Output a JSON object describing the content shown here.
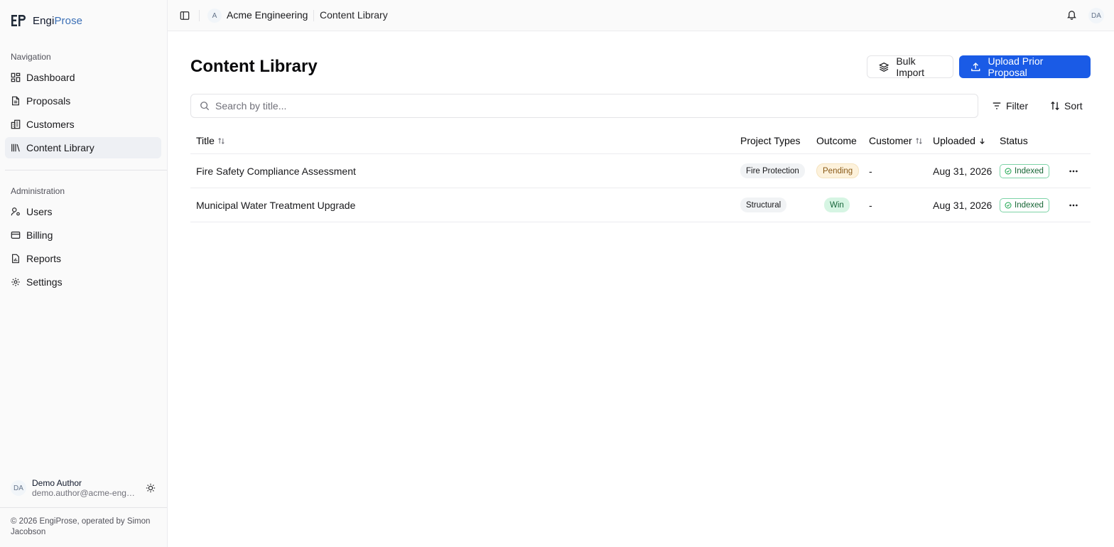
{
  "app": {
    "brand_prefix": "Engi",
    "brand_accent": "Prose",
    "brand_color": "#3b6fb6",
    "primary_color": "#1a5be6"
  },
  "sidebar": {
    "nav_label": "Navigation",
    "nav_items": [
      {
        "label": "Dashboard",
        "icon": "dashboard-icon"
      },
      {
        "label": "Proposals",
        "icon": "document-icon"
      },
      {
        "label": "Customers",
        "icon": "building-icon"
      },
      {
        "label": "Content Library",
        "icon": "library-icon",
        "active": true
      }
    ],
    "admin_label": "Administration",
    "admin_items": [
      {
        "label": "Users",
        "icon": "user-cog-icon"
      },
      {
        "label": "Billing",
        "icon": "credit-card-icon"
      },
      {
        "label": "Reports",
        "icon": "report-icon"
      },
      {
        "label": "Settings",
        "icon": "gear-icon"
      }
    ],
    "user": {
      "initials": "DA",
      "name": "Demo Author",
      "email": "demo.author@acme-engineering.com"
    },
    "footer": "© 2026 EngiProse, operated by Simon Jacobson"
  },
  "topbar": {
    "org_initial": "A",
    "org_name": "Acme Engineering",
    "breadcrumb": "Content Library",
    "user_initials": "DA"
  },
  "main": {
    "title": "Content Library",
    "bulk_import_label": "Bulk Import",
    "upload_label": "Upload Prior Proposal",
    "search_placeholder": "Search by title...",
    "filter_label": "Filter",
    "sort_label": "Sort",
    "columns": {
      "title": "Title",
      "types": "Project Types",
      "outcome": "Outcome",
      "customer": "Customer",
      "uploaded": "Uploaded",
      "status": "Status"
    },
    "rows": [
      {
        "title": "Fire Safety Compliance Assessment",
        "project_type": "Fire Protection",
        "outcome": "Pending",
        "customer": "-",
        "uploaded": "Aug 31, 2026",
        "status": "Indexed"
      },
      {
        "title": "Municipal Water Treatment Upgrade",
        "project_type": "Structural",
        "outcome": "Win",
        "customer": "-",
        "uploaded": "Aug 31, 2026",
        "status": "Indexed"
      }
    ]
  }
}
